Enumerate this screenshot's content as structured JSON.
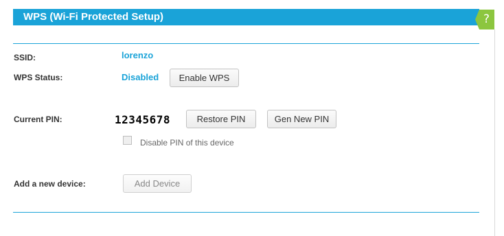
{
  "header": {
    "title": "WPS (Wi-Fi Protected Setup)"
  },
  "help": {
    "icon": "help-icon",
    "glyph": "?",
    "color": "#8cc63f"
  },
  "ssid": {
    "label": "SSID:",
    "value": "lorenzo"
  },
  "wps_status": {
    "label": "WPS Status:",
    "value": "Disabled",
    "button_label": "Enable WPS"
  },
  "current_pin": {
    "label": "Current PIN:",
    "value": "12345678",
    "restore_button": "Restore PIN",
    "gen_button": "Gen New PIN",
    "disable_checkbox_label": "Disable PIN of this device",
    "disable_checked": false
  },
  "add_device": {
    "label": "Add a new device:",
    "button_label": "Add Device",
    "button_enabled": false
  },
  "colors": {
    "accent": "#1aa3d8",
    "help_green": "#8cc63f"
  }
}
